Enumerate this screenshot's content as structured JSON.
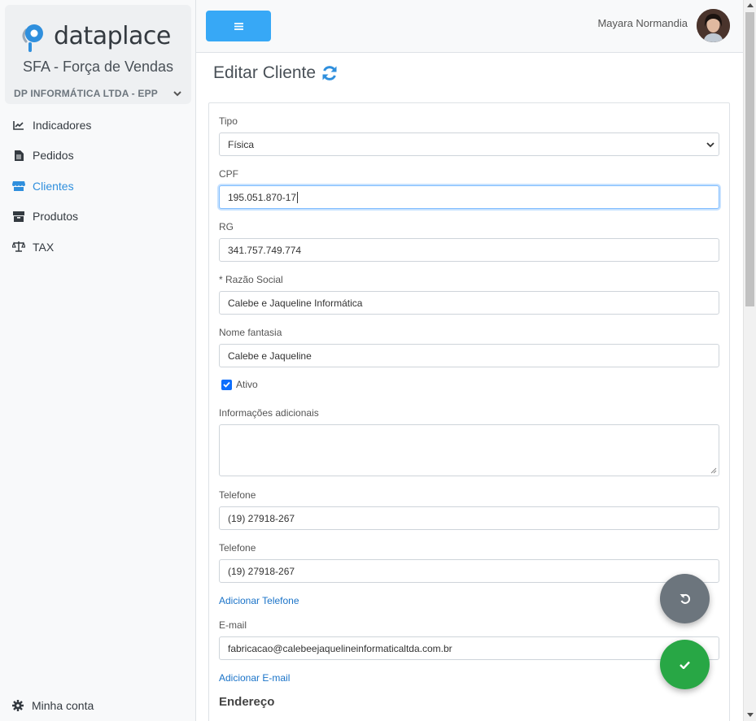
{
  "brand": {
    "logo_text": "dataplace",
    "app_name": "SFA - Força de Vendas",
    "company": "DP INFORMÁTICA LTDA - EPP"
  },
  "nav": {
    "items": [
      {
        "label": "Indicadores",
        "icon": "chart-line-icon"
      },
      {
        "label": "Pedidos",
        "icon": "file-icon"
      },
      {
        "label": "Clientes",
        "icon": "store-icon",
        "active": true
      },
      {
        "label": "Produtos",
        "icon": "box-icon"
      },
      {
        "label": "TAX",
        "icon": "balance-scale-icon"
      }
    ],
    "account_label": "Minha conta"
  },
  "header": {
    "user_name": "Mayara Normandia"
  },
  "page": {
    "title": "Editar Cliente"
  },
  "form": {
    "tipo": {
      "label": "Tipo",
      "value": "Física"
    },
    "cpf": {
      "label": "CPF",
      "value": "195.051.870-17"
    },
    "rg": {
      "label": "RG",
      "value": "341.757.749.774"
    },
    "razao_social": {
      "label": "* Razão Social",
      "value": "Calebe e Jaqueline Informática"
    },
    "nome_fantasia": {
      "label": "Nome fantasia",
      "value": "Calebe e Jaqueline"
    },
    "ativo": {
      "label": "Ativo",
      "checked": true
    },
    "info": {
      "label": "Informações adicionais",
      "value": ""
    },
    "telefone1": {
      "label": "Telefone",
      "value": "(19) 27918-267"
    },
    "telefone2": {
      "label": "Telefone",
      "value": "(19) 27918-267"
    },
    "add_telefone": "Adicionar Telefone",
    "email": {
      "label": "E-mail",
      "value": "fabricacao@calebeejaquelineinformaticaltda.com.br"
    },
    "add_email": "Adicionar E-mail",
    "endereco_heading": "Endereço"
  },
  "colors": {
    "accent": "#37a8f6",
    "active_nav": "#2f8fdd",
    "success": "#28a745",
    "secondary": "#6c757d",
    "link": "#1a73c8"
  }
}
